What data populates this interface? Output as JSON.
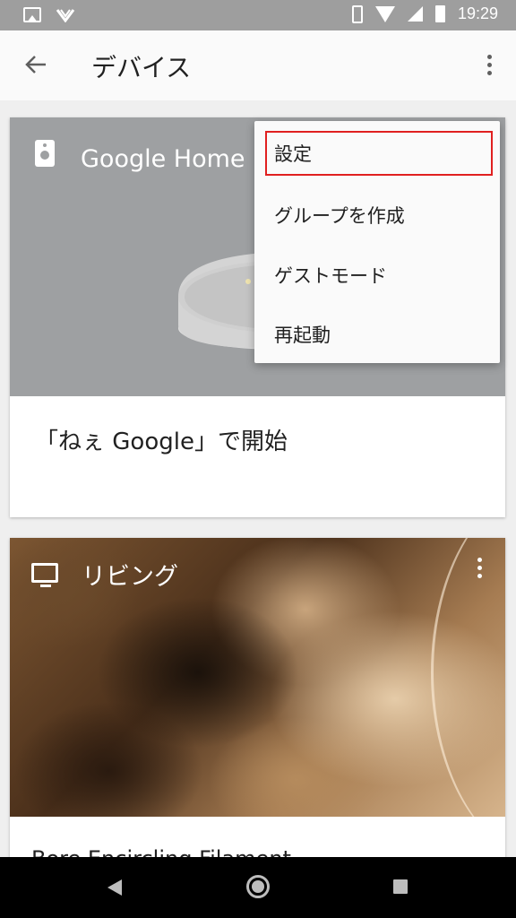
{
  "status_bar": {
    "time": "19:29",
    "icons": [
      "image-icon",
      "vpn-icon",
      "vibrate-icon",
      "wifi-icon",
      "signal-icon",
      "battery-icon"
    ]
  },
  "app_bar": {
    "back_icon": "arrow-back-icon",
    "title": "デバイス",
    "overflow_icon": "more-vert-icon"
  },
  "cards": {
    "google_home": {
      "device_name": "Google Home リ",
      "device_icon": "speaker-icon",
      "action_text": "「ねぇ Google」で開始"
    },
    "living": {
      "room_name": "リビング",
      "device_icon": "tv-icon",
      "media_title": "Bore Encircling Filament"
    }
  },
  "overflow_menu": {
    "items": [
      {
        "label": "設定"
      },
      {
        "label": "グループを作成"
      },
      {
        "label": "ゲストモード"
      },
      {
        "label": "再起動"
      }
    ]
  },
  "colors": {
    "status_bar": "#9e9e9e",
    "hero_gray": "#9ea0a2",
    "highlight": "#e02020"
  },
  "nav_bar": {
    "icons": [
      "nav-back-icon",
      "nav-home-icon",
      "nav-recents-icon"
    ]
  }
}
